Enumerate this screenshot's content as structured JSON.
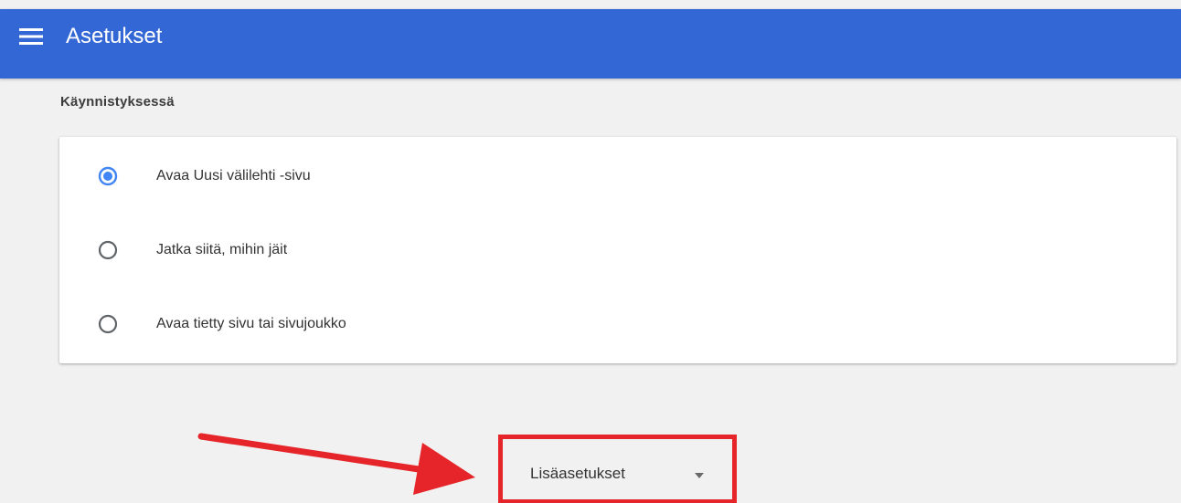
{
  "header": {
    "title": "Asetukset",
    "menu_icon": "hamburger-icon",
    "background_color": "#3367d6"
  },
  "startup": {
    "section_title": "Käynnistyksessä",
    "selected_index": 0,
    "options": [
      {
        "label": "Avaa Uusi välilehti -sivu",
        "selected": true
      },
      {
        "label": "Jatka siitä, mihin jäit",
        "selected": false
      },
      {
        "label": "Avaa tietty sivu tai sivujoukko",
        "selected": false
      }
    ]
  },
  "advanced": {
    "label": "Lisäasetukset",
    "icon": "chevron-down-icon",
    "highlight_color": "#e5252a"
  },
  "colors": {
    "accent": "#3367d6",
    "radio_selected": "#4285f4",
    "radio_unselected": "#5f6368",
    "annotation_red": "#e5252a",
    "page_background": "#f1f1f1"
  }
}
